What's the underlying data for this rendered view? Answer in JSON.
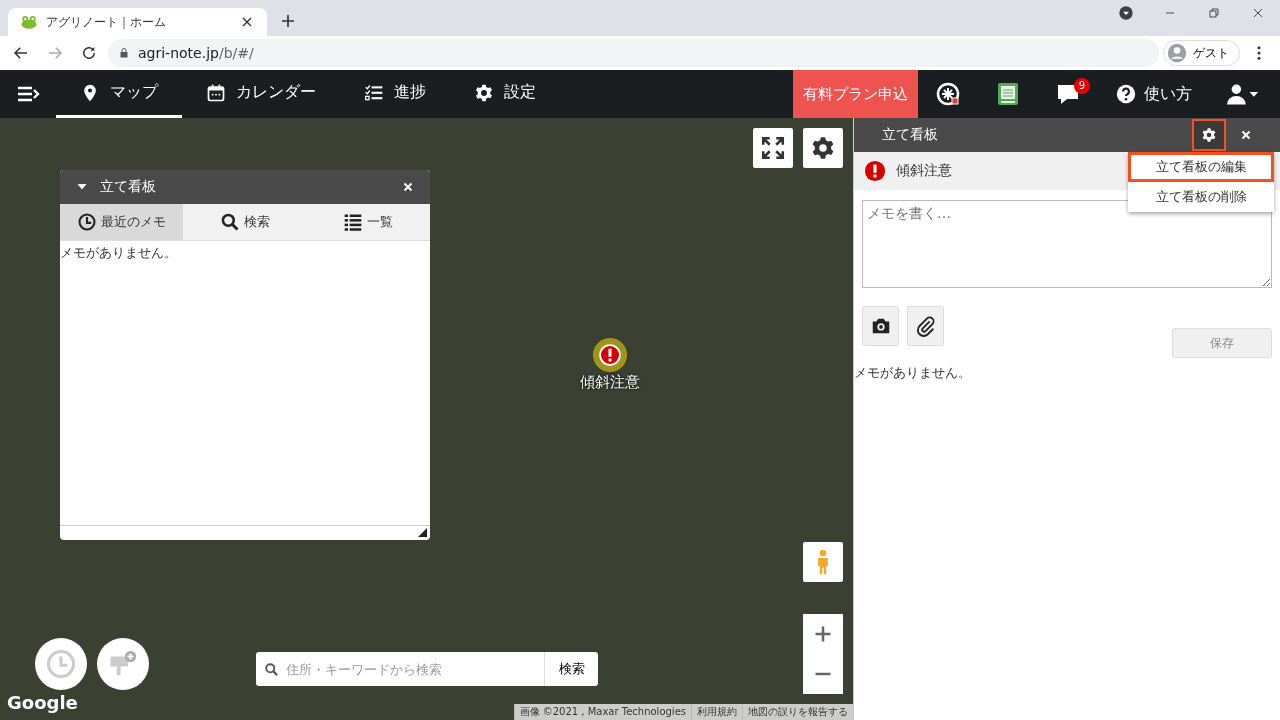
{
  "browser": {
    "tab_title": "アグリノート｜ホーム",
    "url_host": "agri-note.jp",
    "url_path": "/b/#/",
    "profile": "ゲスト"
  },
  "nav": {
    "items": [
      {
        "label": "マップ",
        "selected": true
      },
      {
        "label": "カレンダー",
        "selected": false
      },
      {
        "label": "進捗",
        "selected": false
      },
      {
        "label": "設定",
        "selected": false
      }
    ],
    "plan_button": "有料プラン申込",
    "notification_count": "9",
    "help": "使い方"
  },
  "map": {
    "panel": {
      "title": "立て看板",
      "tabs": [
        {
          "label": "最近のメモ",
          "selected": true
        },
        {
          "label": "検索",
          "selected": false
        },
        {
          "label": "一覧",
          "selected": false
        }
      ],
      "empty_text": "メモがありません。"
    },
    "marker_label": "傾斜注意",
    "search": {
      "placeholder": "住所・キーワードから検索",
      "button": "検索"
    },
    "logo": "Google",
    "attribution": [
      "画像 ©2021 , Maxar Technologies",
      "利用規約",
      "地図の誤りを報告する"
    ]
  },
  "side_panel": {
    "title": "立て看板",
    "gear_highlighted": true,
    "sign_name": "傾斜注意",
    "menu": [
      {
        "label": "立て看板の編集",
        "highlighted": true
      },
      {
        "label": "立て看板の削除",
        "highlighted": false
      }
    ],
    "memo_placeholder": "メモを書く…",
    "save_button": "保存",
    "save_disabled": true,
    "empty_text": "メモがありません。"
  }
}
